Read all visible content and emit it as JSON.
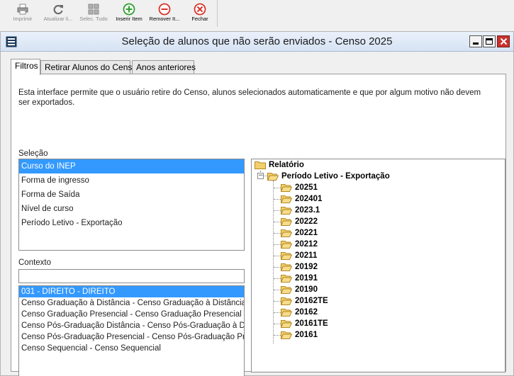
{
  "toolbar": {
    "buttons": [
      {
        "label": "Imprimir",
        "icon": "printer-icon",
        "enabled": false
      },
      {
        "label": "Atualizar li...",
        "icon": "refresh-icon",
        "enabled": false
      },
      {
        "label": "Selec. Tudo",
        "icon": "select-all-icon",
        "enabled": false
      },
      {
        "label": "Inserir Item",
        "icon": "plus-circle-icon",
        "enabled": true
      },
      {
        "label": "Remover It...",
        "icon": "minus-circle-icon",
        "enabled": true
      },
      {
        "label": "Fechar",
        "icon": "close-circle-icon",
        "enabled": true
      }
    ]
  },
  "window": {
    "title": "Seleção de alunos que não serão enviados - Censo 2025",
    "tabs": [
      {
        "label": "Filtros",
        "active": true
      },
      {
        "label": "Retirar Alunos do Censo",
        "active": false
      },
      {
        "label": "Anos anteriores",
        "active": false
      }
    ]
  },
  "filtros": {
    "intro": "Esta interface permite que o usuário retire do Censo, alunos selecionados automaticamente e que por algum motivo não devem ser exportados.",
    "selecao_label": "Seleção",
    "selecao_items": [
      "Curso do INEP",
      "Forma de ingresso",
      "Forma de Saída",
      "Nível de curso",
      "Período Letivo - Exportação"
    ],
    "selecao_selected": 0,
    "contexto_label": "Contexto",
    "contexto_filter_value": "",
    "contexto_items": [
      "031 - DIREITO - DIREITO",
      "Censo Graduação à Distância - Censo Graduação à Distância",
      "Censo Graduação Presencial - Censo Graduação Presencial",
      "Censo Pós-Graduação Distância - Censo Pós-Graduação à Distância",
      "Censo Pós-Graduação Presencial - Censo Pós-Graduação Presencial",
      "Censo Sequencial - Censo Sequencial"
    ],
    "contexto_selected": 0
  },
  "tree": {
    "root": "Relatório",
    "child": "Período Letivo - Exportação",
    "leaves": [
      "20251",
      "202401",
      "2023.1",
      "20222",
      "20221",
      "20212",
      "20211",
      "20192",
      "20191",
      "20190",
      "20162TE",
      "20162",
      "20161TE",
      "20161"
    ]
  },
  "colors": {
    "selection": "#3399ff",
    "add": "#2e9e2e",
    "remove": "#d9342b",
    "close_button": "#c9302c",
    "folder": "#f3cf6b"
  }
}
